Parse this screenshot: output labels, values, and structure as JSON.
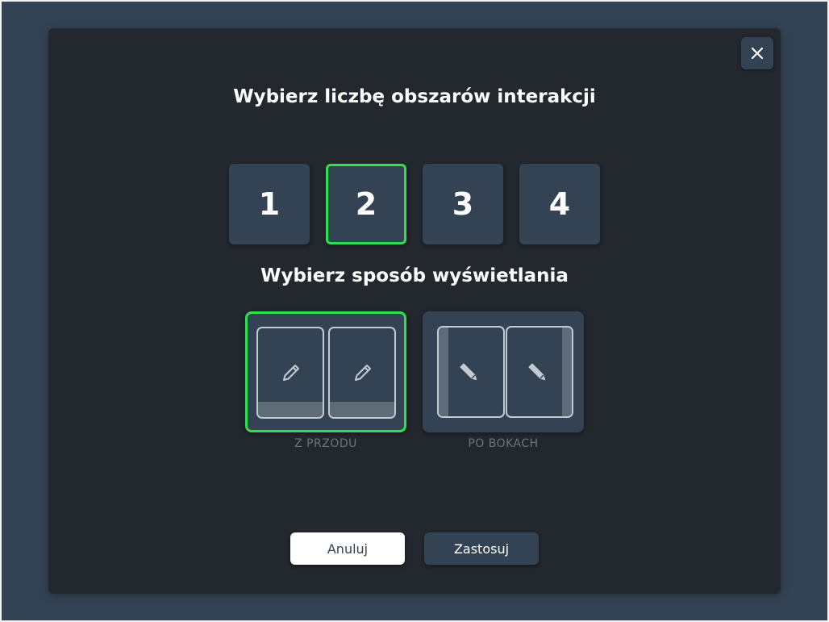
{
  "dialog": {
    "close_icon": "close-icon",
    "heading_count": "Wybierz liczbę obszarów interakcji",
    "heading_display": "Wybierz sposób wyświetlania",
    "counts": [
      "1",
      "2",
      "3",
      "4"
    ],
    "selected_count": "2",
    "modes": [
      {
        "label": "Z PRZODU",
        "icon": "pencil-icon",
        "selected": true
      },
      {
        "label": "PO BOKACH",
        "icon": "pencil-icon",
        "selected": false
      }
    ],
    "cancel_label": "Anuluj",
    "apply_label": "Zastosuj"
  },
  "colors": {
    "background": "#344353",
    "modal": "#23272e",
    "tile": "#344353",
    "accent_selected": "#2de04f",
    "muted_label": "#6c737c",
    "cancel_bg": "#ffffff"
  }
}
